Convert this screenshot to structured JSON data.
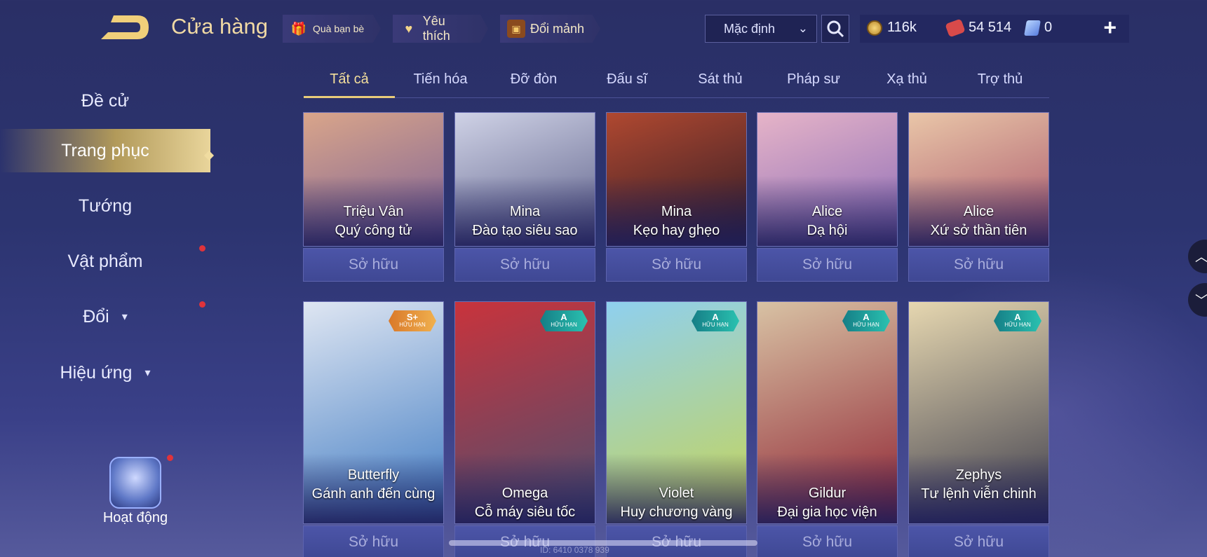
{
  "header": {
    "title": "Cửa hàng",
    "buttons": [
      {
        "label": "Quà bạn bè",
        "icon": "gift-icon"
      },
      {
        "label": "Yêu thích",
        "icon": "heart-icon"
      },
      {
        "label": "Đổi mảnh",
        "icon": "chest-icon"
      }
    ],
    "sort": {
      "value": "Mặc định"
    },
    "currencies": {
      "gold": "116k",
      "voucher": "54 514",
      "gem": "0"
    }
  },
  "sidebar": {
    "items": [
      {
        "label": "Đề cử"
      },
      {
        "label": "Trang phục"
      },
      {
        "label": "Tướng"
      },
      {
        "label": "Vật phẩm"
      },
      {
        "label": "Đổi"
      },
      {
        "label": "Hiệu ứng"
      }
    ],
    "activity_label": "Hoạt động"
  },
  "tabs": [
    "Tất cả",
    "Tiến hóa",
    "Đỡ đòn",
    "Đấu sĩ",
    "Sát thủ",
    "Pháp sư",
    "Xạ thủ",
    "Trợ thủ"
  ],
  "cards": [
    {
      "hero": "Triệu Vân",
      "skin": "Quý công tử",
      "status": "Sở hữu",
      "color1": "#d9a58a",
      "color2": "#7a5f96"
    },
    {
      "hero": "Mina",
      "skin": "Đào tạo siêu sao",
      "status": "Sở hữu",
      "color1": "#cfd2e6",
      "color2": "#5c5f88"
    },
    {
      "hero": "Mina",
      "skin": "Kẹo hay ghẹo",
      "status": "Sở hữu",
      "color1": "#b04830",
      "color2": "#2b1a26"
    },
    {
      "hero": "Alice",
      "skin": "Dạ hội",
      "status": "Sở hữu",
      "color1": "#e6b4c8",
      "color2": "#8a6ab6"
    },
    {
      "hero": "Alice",
      "skin": "Xứ sở thần tiên",
      "status": "Sở hữu",
      "color1": "#e9c6a8",
      "color2": "#a8546a"
    },
    {
      "hero": "Butterfly",
      "skin": "Gánh anh đến cùng",
      "status": "Sở hữu",
      "grade": "S+",
      "grade_sub": "HỮU HẠN",
      "color1": "#dfe6f2",
      "color2": "#3e7ac2"
    },
    {
      "hero": "Omega",
      "skin": "Cỗ máy siêu tốc",
      "status": "Sở hữu",
      "grade": "A",
      "grade_sub": "HỮU HẠN",
      "color1": "#c9333c",
      "color2": "#4b4f70"
    },
    {
      "hero": "Violet",
      "skin": "Huy chương vàng",
      "status": "Sở hữu",
      "grade": "A",
      "grade_sub": "HỮU HẠN",
      "color1": "#8fd0ef",
      "color2": "#c7d455"
    },
    {
      "hero": "Gildur",
      "skin": "Đại gia học viện",
      "status": "Sở hữu",
      "grade": "A",
      "grade_sub": "HỮU HẠN",
      "color1": "#d8c2a4",
      "color2": "#8e2131"
    },
    {
      "hero": "Zephys",
      "skin": "Tư lệnh viễn chinh",
      "status": "Sở hữu",
      "grade": "A",
      "grade_sub": "HỮU HẠN",
      "color1": "#e6d7b0",
      "color2": "#3a3a4a"
    }
  ],
  "footer": {
    "uid": "ID: 6410 0378 939"
  },
  "colors": {
    "accent": "#e8cc7a",
    "badge_gold": "#e9993a",
    "badge_teal": "#1fa6a0",
    "red_dot": "#e0333b"
  }
}
